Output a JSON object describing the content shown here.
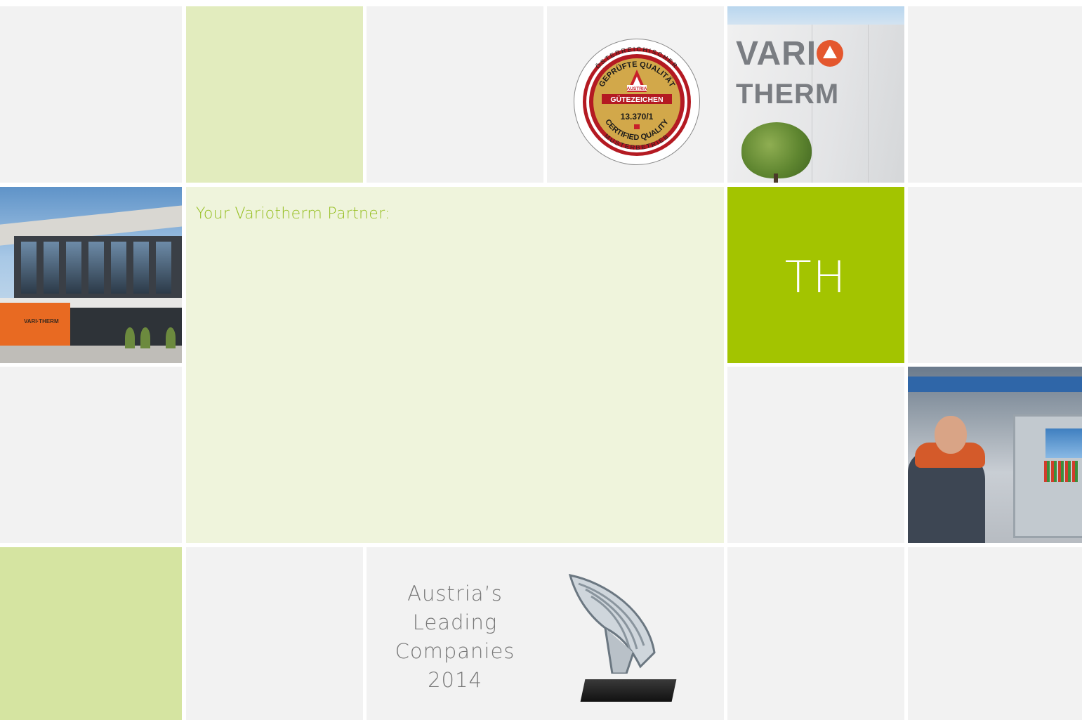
{
  "partner": {
    "label": "Your Variotherm Partner:",
    "initials": "TH"
  },
  "award": {
    "lines": [
      "Austria’s",
      "Leading",
      "Companies",
      "2014"
    ]
  },
  "photos": {
    "building_sign": {
      "sign_text_left": "VARI",
      "sign_text_right": "THERM"
    },
    "building_entrance": {
      "sign_text": "VARI·THERM"
    }
  },
  "seal": {
    "arc_top": "ÖSTERREICHISCHER",
    "arc_inner_top": "GEPRÜFTE QUALITÄT",
    "austria": "AUSTRIA",
    "band": "GÜTEZEICHEN",
    "number": "13.370/1",
    "arc_inner_bottom": "CERTIFIED QUALITY",
    "arc_bottom": "MUSTERBETRIEB"
  },
  "colors": {
    "grey_tile": "#f2f2f2",
    "light_green_tile": "#e2ecbe",
    "mid_green_tile": "#d5e4a1",
    "pale_green_tile": "#eff4dc",
    "bright_green_tile": "#a3c400",
    "partner_label": "#95be1f"
  }
}
